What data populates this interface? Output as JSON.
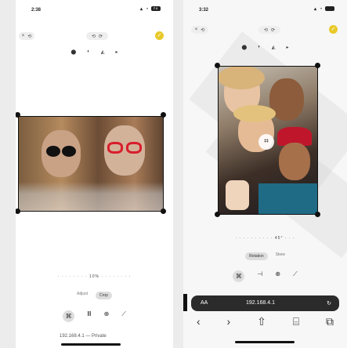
{
  "left": {
    "status": {
      "time": "2:38",
      "signal": "▴ ◔",
      "battery": "72"
    },
    "toolbar": {
      "close": "×",
      "undo": "⟲",
      "redo1": "⟲",
      "redo2": "⟳",
      "done": "✓"
    },
    "top_tools": [
      "⬤",
      "◐",
      "◭",
      "▸"
    ],
    "rotation_dial": "· · · · · · · · 10% · · · · · · · ·",
    "modes": [
      "Adjust",
      "Crop"
    ],
    "edit_tabs": [
      "⌘",
      "Ⅲ",
      "⊕",
      "⟋"
    ],
    "url": "192.168.4.1 — Private"
  },
  "right": {
    "status": {
      "time": "3:32",
      "signal": "▴ ◔"
    },
    "toolbar": {
      "close": "×",
      "undo": "⟲",
      "redo1": "⟲",
      "redo2": "⟳",
      "done": "✓"
    },
    "top_tools": [
      "⬤",
      "◐",
      "◭",
      "▸"
    ],
    "rotation_dial": "· · · · · · · · · · 45° · · ·",
    "modes": [
      "Rotation",
      "Skew"
    ],
    "edit_tabs": [
      "⌘",
      "⊣",
      "⊕",
      "⟋"
    ],
    "safari": {
      "aa": "AA",
      "address": "192.168.4.1",
      "reload": "↻",
      "dock": "▌"
    },
    "nav": [
      "‹",
      "›",
      "⇧",
      "⌸",
      "⧉"
    ]
  }
}
